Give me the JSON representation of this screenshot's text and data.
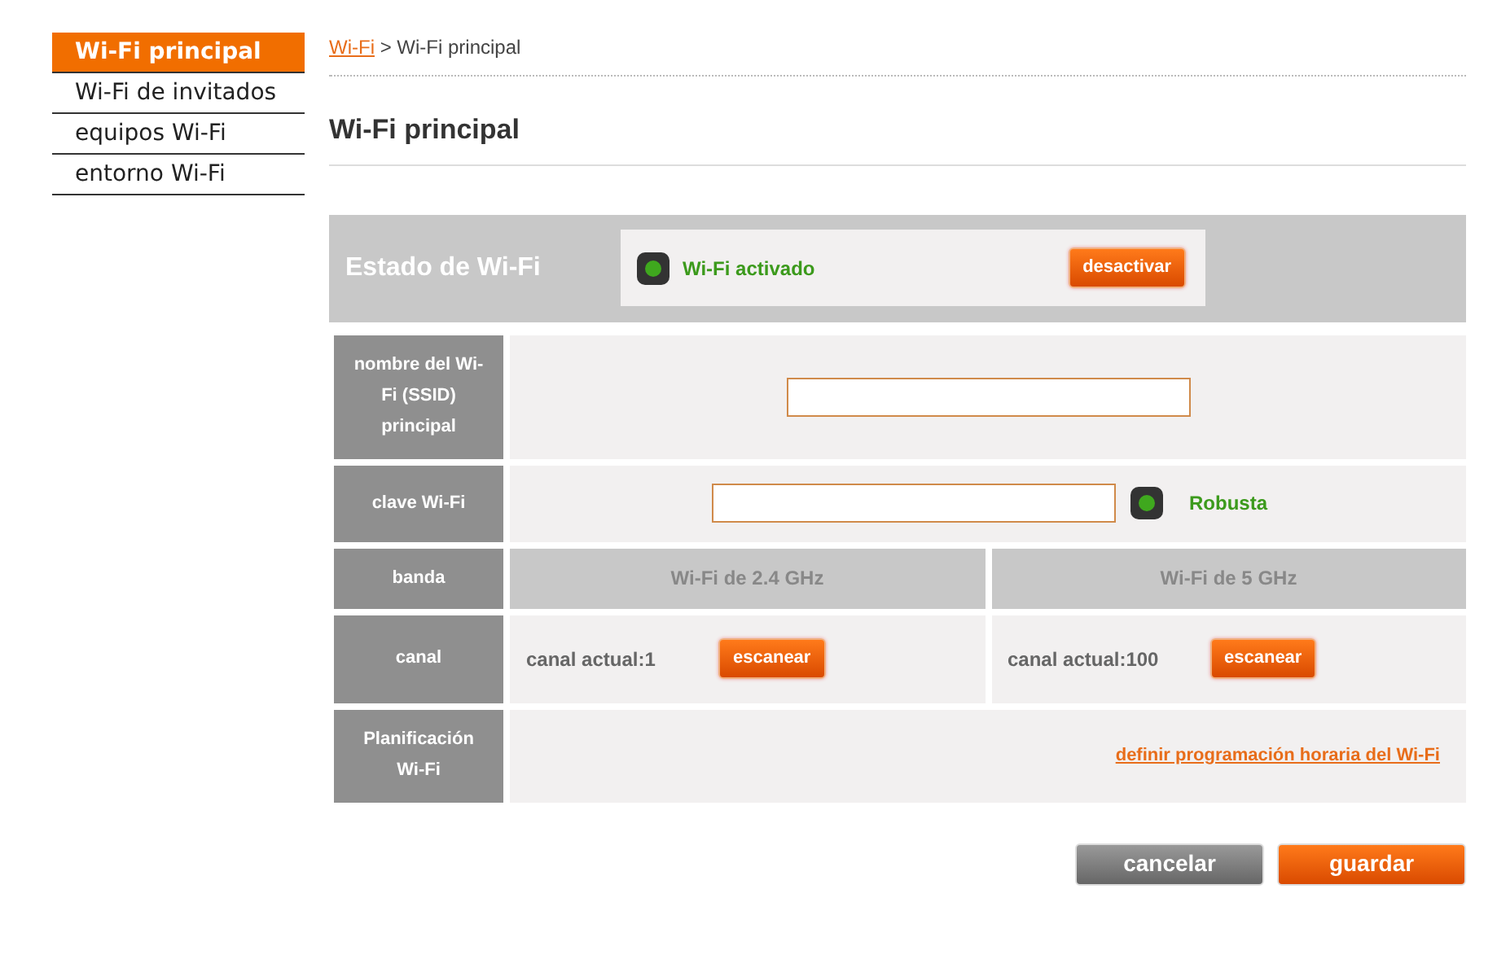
{
  "sidebar": {
    "items": [
      {
        "label": "Wi-Fi principal",
        "selected": true
      },
      {
        "label": "Wi-Fi de invitados",
        "selected": false
      },
      {
        "label": "equipos Wi-Fi",
        "selected": false
      },
      {
        "label": "entorno Wi-Fi",
        "selected": false
      }
    ]
  },
  "breadcrumb": {
    "link": "Wi-Fi",
    "rest": "> Wi-Fi principal"
  },
  "title": "Wi-Fi principal",
  "status": {
    "label": "Estado de Wi-Fi",
    "on": true,
    "state_text": "Wi-Fi activado",
    "button": "desactivar"
  },
  "ssid": {
    "label": "nombre del Wi-Fi (SSID) principal"
  },
  "password": {
    "label": "clave Wi-Fi",
    "strong": true,
    "strength": "Robusta"
  },
  "band": {
    "label": "banda",
    "bands": [
      "Wi-Fi de 2.4 GHz",
      "Wi-Fi de 5 GHz"
    ]
  },
  "channel": {
    "label": "canal",
    "cells": [
      {
        "text": "canal actual:1",
        "button": "escanear"
      },
      {
        "text": "canal actual:100",
        "button": "escanear"
      }
    ]
  },
  "schedule": {
    "label": "Planificación Wi-Fi",
    "link": "definir programación horaria del Wi-Fi"
  },
  "buttons": [
    {
      "label": "cancelar",
      "kind": "secondary"
    },
    {
      "label": "guardar",
      "kind": "primary"
    }
  ]
}
